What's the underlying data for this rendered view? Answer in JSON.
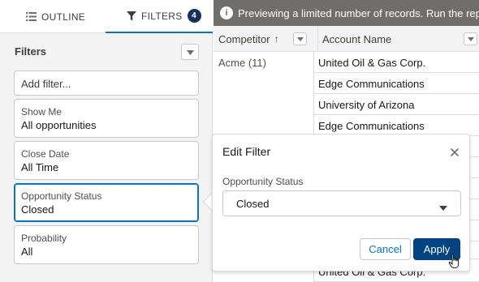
{
  "tabs": {
    "outline_label": "OUTLINE",
    "filters_label": "FILTERS",
    "filters_count": "4"
  },
  "filters_panel": {
    "heading": "Filters",
    "add_filter_placeholder": "Add filter...",
    "items": [
      {
        "label": "Show Me",
        "value": "All opportunities"
      },
      {
        "label": "Close Date",
        "value": "All Time"
      },
      {
        "label": "Opportunity Status",
        "value": "Closed"
      },
      {
        "label": "Probability",
        "value": "All"
      }
    ]
  },
  "banner": {
    "text": "Previewing a limited number of records. Run the report to see everything."
  },
  "table": {
    "columns": [
      "Competitor",
      "Account Name"
    ],
    "sort_indicator": "↑",
    "group_label": "Acme (11)",
    "rows": [
      "United Oil & Gas Corp.",
      "Edge Communications",
      "University of Arizona",
      "Edge Communications",
      "",
      "",
      "",
      "",
      "",
      "United Oil & Gas Corp."
    ]
  },
  "popover": {
    "title": "Edit Filter",
    "field_label": "Opportunity Status",
    "selected_value": "Closed",
    "cancel_label": "Cancel",
    "apply_label": "Apply"
  },
  "colors": {
    "brand_blue": "#0176d3",
    "apply_blue": "#014486",
    "badge_navy": "#16325c",
    "banner_gray": "#706e6b"
  },
  "icons": [
    "list-icon",
    "filter-icon",
    "chevron-down-icon",
    "info-icon",
    "close-icon",
    "hand-cursor-icon"
  ]
}
